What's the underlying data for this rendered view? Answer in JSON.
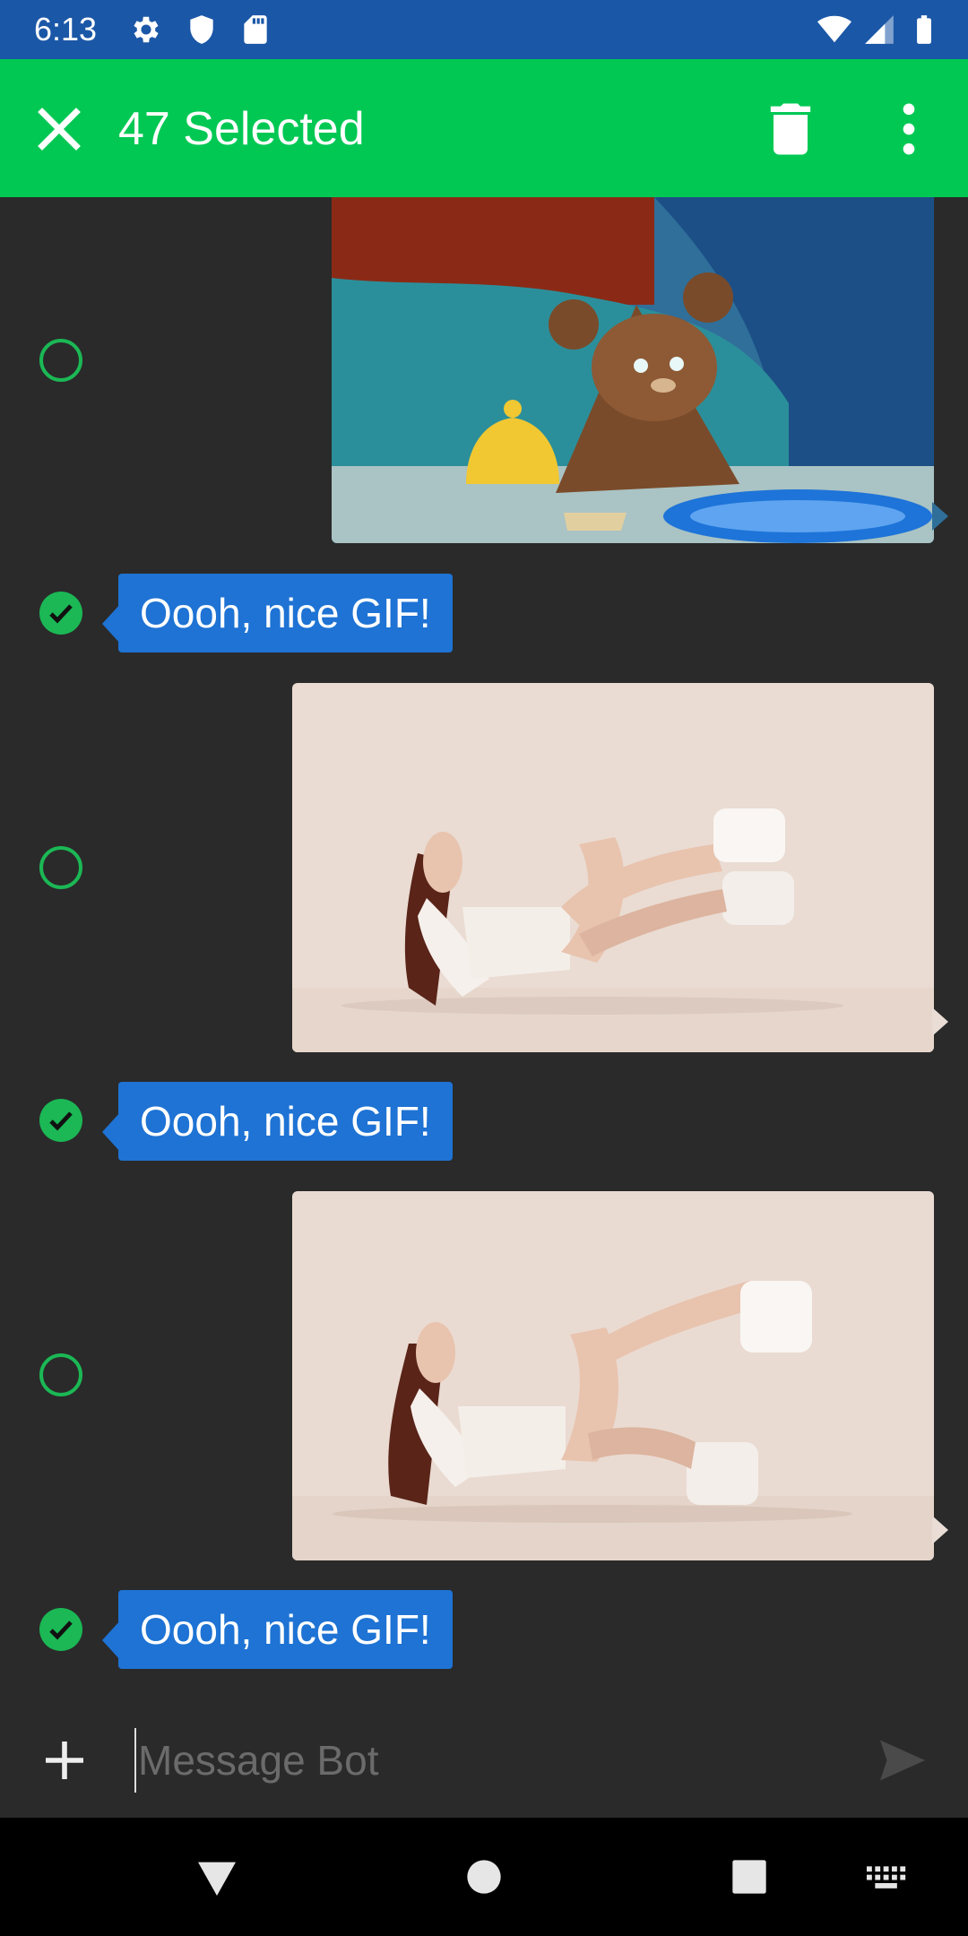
{
  "status_bar": {
    "time": "6:13",
    "icons": [
      "settings-icon",
      "shield-icon",
      "sd-card-icon",
      "wifi-icon",
      "cell-signal-icon",
      "battery-icon"
    ]
  },
  "app_bar": {
    "title": "47 Selected",
    "close_icon": "close-icon",
    "delete_icon": "delete-icon",
    "more_icon": "more-vert-icon",
    "color": "#00c853"
  },
  "messages": [
    {
      "type": "gif",
      "selected": false
    },
    {
      "type": "text",
      "selected": true,
      "text": "Oooh, nice GIF!"
    },
    {
      "type": "gif",
      "selected": false
    },
    {
      "type": "text",
      "selected": true,
      "text": "Oooh, nice GIF!"
    },
    {
      "type": "gif",
      "selected": false
    },
    {
      "type": "text",
      "selected": true,
      "text": "Oooh, nice GIF!"
    }
  ],
  "composer": {
    "placeholder": "Message Bot",
    "add_icon": "plus-icon",
    "send_icon": "send-icon"
  },
  "nav_bar": {
    "icons": [
      "back-icon",
      "home-icon",
      "recents-icon",
      "keyboard-icon"
    ]
  },
  "colors": {
    "accent": "#1bb855",
    "bubble": "#1e73d4",
    "background": "#2a2a2a",
    "status_bar": "#1b57a7"
  }
}
